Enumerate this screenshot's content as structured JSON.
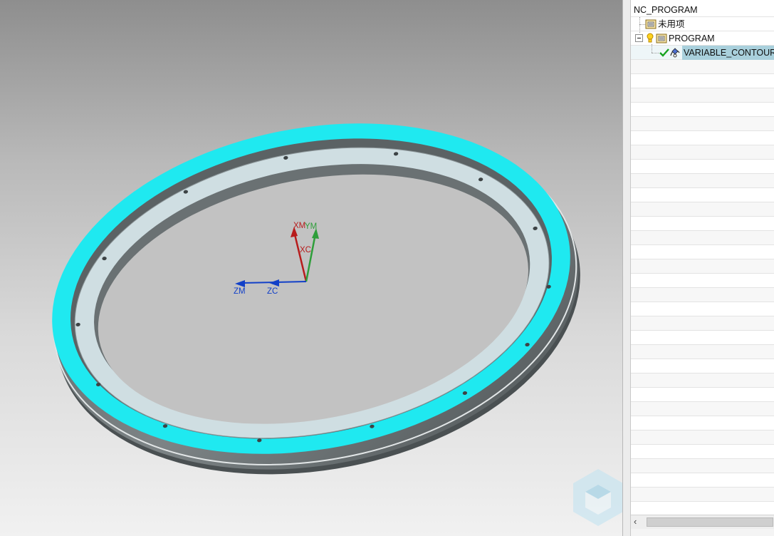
{
  "navigator": {
    "root": "NC_PROGRAM",
    "unused_items": "未用项",
    "program": "PROGRAM",
    "operation": "VARIABLE_CONTOUR",
    "operation_status": "complete-check-icon"
  },
  "csys": {
    "xm": "XM",
    "ym": "YM",
    "xc": "XC",
    "zm": "ZM",
    "zc": "ZC"
  },
  "colors": {
    "ring_highlight": "#1fe9f0",
    "part_body": "#6f7577",
    "inner_face": "#cfdee2",
    "axis_x": "#b71c1c",
    "axis_y": "#2e9e3a",
    "axis_z": "#1240c8",
    "selection": "#a9d0dc"
  }
}
